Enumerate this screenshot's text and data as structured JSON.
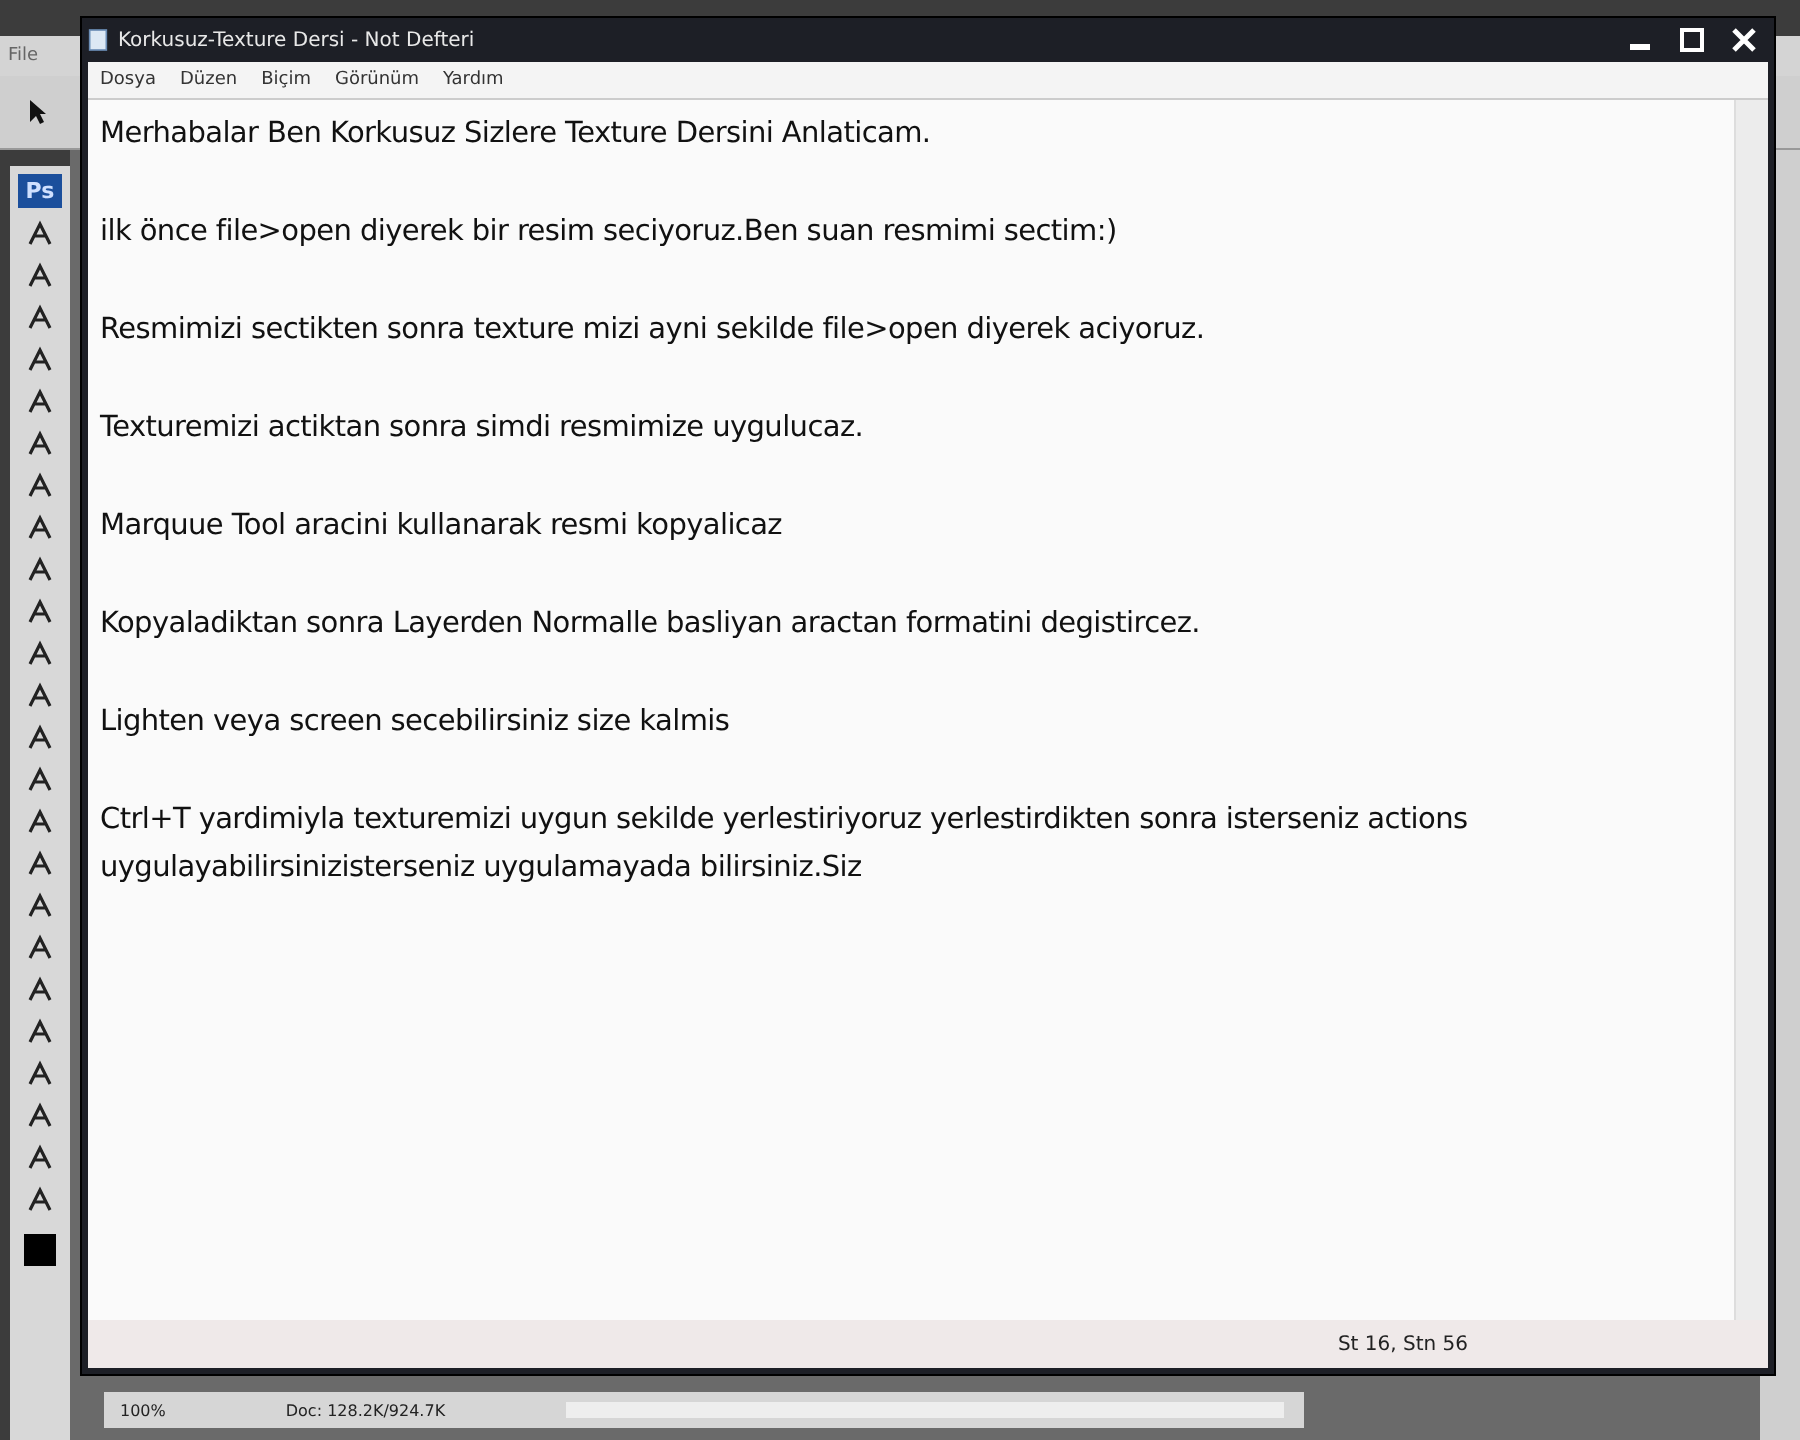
{
  "photoshop": {
    "menu": [
      "File"
    ],
    "badge": "Ps",
    "zoom": "100%",
    "doc": "Doc: 128.2K/924.7K"
  },
  "window": {
    "title": "Korkusuz-Texture Dersi - Not Defteri"
  },
  "menu": [
    "Dosya",
    "Düzen",
    "Biçim",
    "Görünüm",
    "Yardım"
  ],
  "paragraphs": [
    [
      "Merhabalar Ben Korkusuz Sizlere Texture Dersini Anlaticam."
    ],
    [
      "ilk önce file>open diyerek bir resim seciyoruz.Ben suan resmimi sectim:)"
    ],
    [
      "Resmimizi sectikten sonra texture mizi ayni sekilde file>open diyerek aciyoruz."
    ],
    [
      "Texturemizi actiktan sonra simdi resmimize uygulucaz."
    ],
    [
      "Marquue Tool aracini kullanarak resmi kopyalicaz"
    ],
    [
      "Kopyaladiktan sonra Layerden Normalle basliyan aractan formatini degistircez."
    ],
    [
      "Lighten veya screen secebilirsiniz size kalmis"
    ],
    [
      "Ctrl+T yardimiyla texturemizi uygun sekilde yerlestiriyoruz yerlestirdikten sonra isterseniz actions",
      "uygulayabilirsinizisterseniz uygulamayada bilirsiniz.Siz"
    ]
  ],
  "status_bar": "St 16, Stn 56"
}
